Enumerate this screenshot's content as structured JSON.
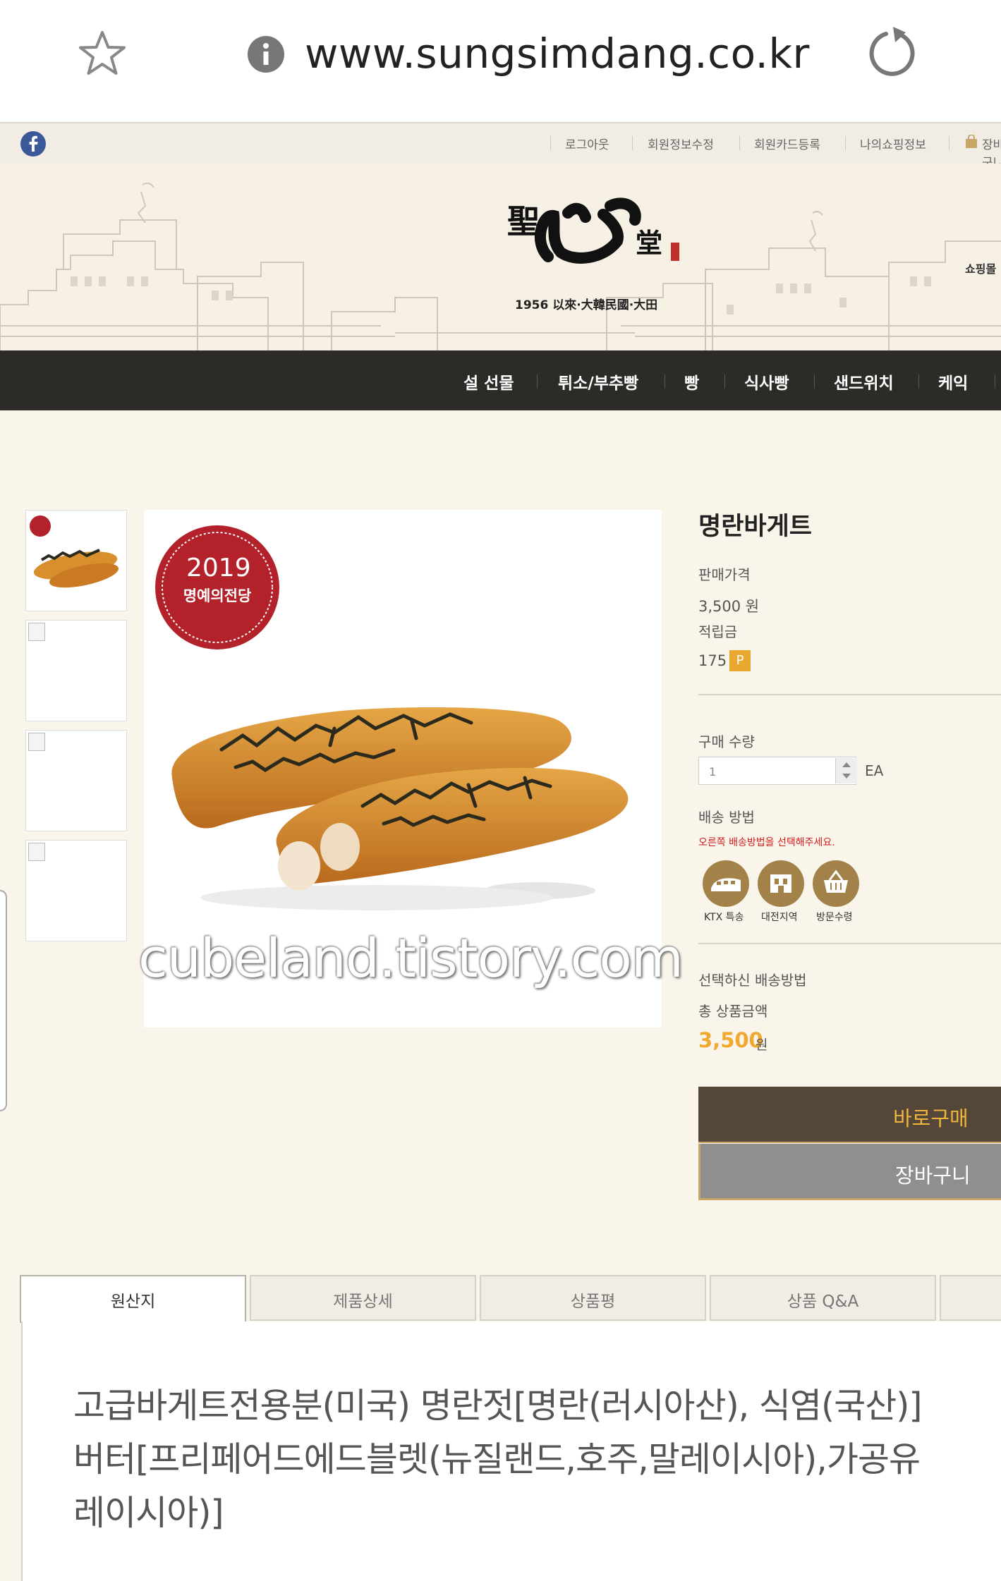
{
  "browser": {
    "url": "www.sungsimdang.co.kr"
  },
  "util_bar": {
    "links": [
      "로그아웃",
      "회원정보수정",
      "회원카드등록",
      "나의쇼핑정보",
      "장바구니"
    ]
  },
  "header": {
    "logo_tagline": "1956 以來·大韓民國·大田",
    "side_link": "쇼핑몰"
  },
  "nav": {
    "items": [
      "설 선물",
      "튀소/부추빵",
      "빵",
      "식사빵",
      "샌드위치",
      "케익"
    ]
  },
  "product": {
    "badge_year": "2019",
    "badge_text": "명예의전당",
    "watermark": "cubeland.tistory.com",
    "title": "명란바게트",
    "price_label": "판매가격",
    "price_value": "3,500 원",
    "points_label": "적립금",
    "points_value": "175",
    "points_badge": "P",
    "qty_label": "구매 수량",
    "qty_value": "1",
    "qty_unit": "EA",
    "shipping_label": "배송 방법",
    "shipping_hint": "오른쪽 배송방법을 선택해주세요.",
    "shipping_options": [
      "KTX 특송",
      "대전지역",
      "방문수령"
    ],
    "selected_shipping_label": "선택하신 배송방법",
    "total_label": "총 상품금액",
    "total_value": "3,500",
    "total_unit": "원",
    "buy_now": "바로구매",
    "cart": "장바구니"
  },
  "tabs": [
    "원산지",
    "제품상세",
    "상품평",
    "상품 Q&A"
  ],
  "origin": {
    "lines": [
      "고급바게트전용분(미국) 명란젓[명란(러시아산), 식염(국산)]",
      "버터[프리페어드에드블렛(뉴질랜드,호주,말레이시아),가공유",
      "레이시아)]"
    ]
  },
  "colors": {
    "nav_bg": "#2d2b28",
    "accent_gold": "#f0b53a",
    "buy_bg": "#55463a",
    "cart_bg": "#8f8f8f",
    "badge_red": "#b3222b"
  }
}
